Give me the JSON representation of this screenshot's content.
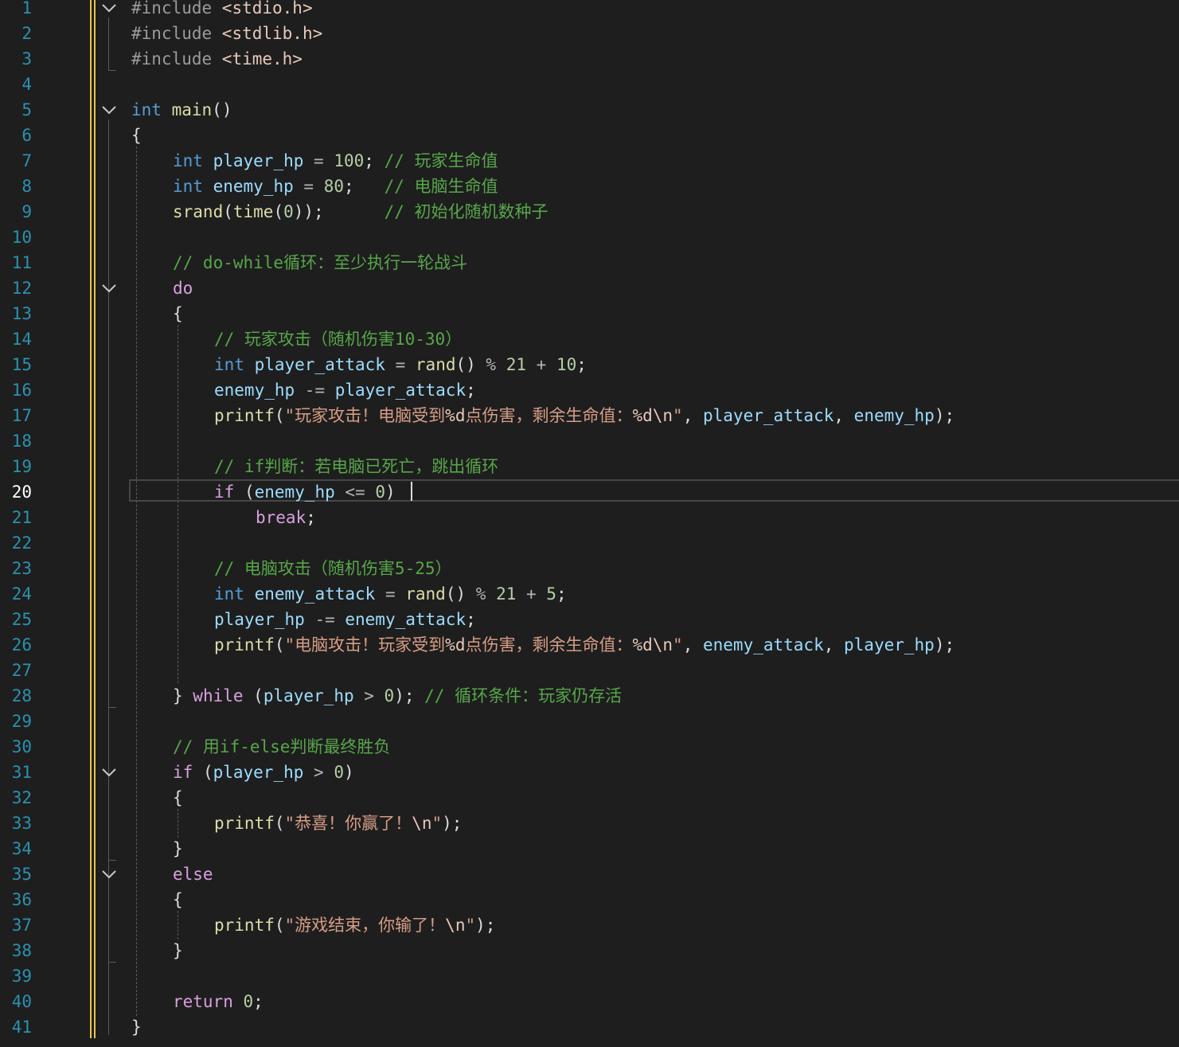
{
  "editor": {
    "active_line": 20,
    "line_numbers": [
      "1",
      "2",
      "3",
      "4",
      "5",
      "6",
      "7",
      "8",
      "9",
      "10",
      "11",
      "12",
      "13",
      "14",
      "15",
      "16",
      "17",
      "18",
      "19",
      "20",
      "21",
      "22",
      "23",
      "24",
      "25",
      "26",
      "27",
      "28",
      "29",
      "30",
      "31",
      "32",
      "33",
      "34",
      "35",
      "36",
      "37",
      "38",
      "39",
      "40",
      "41"
    ],
    "lines": [
      {
        "indent": 0,
        "tokens": [
          {
            "t": "pp",
            "v": "#include "
          },
          {
            "t": "hdr",
            "v": "<stdio.h>"
          }
        ]
      },
      {
        "indent": 0,
        "tokens": [
          {
            "t": "pp",
            "v": "#include "
          },
          {
            "t": "hdr",
            "v": "<stdlib.h>"
          }
        ]
      },
      {
        "indent": 0,
        "tokens": [
          {
            "t": "pp",
            "v": "#include "
          },
          {
            "t": "hdr",
            "v": "<time.h>"
          }
        ]
      },
      {
        "indent": 0,
        "tokens": []
      },
      {
        "indent": 0,
        "tokens": [
          {
            "t": "kw",
            "v": "int"
          },
          {
            "t": "pl",
            "v": " "
          },
          {
            "t": "fn",
            "v": "main"
          },
          {
            "t": "pl",
            "v": "()"
          }
        ]
      },
      {
        "indent": 0,
        "tokens": [
          {
            "t": "pl",
            "v": "{"
          }
        ]
      },
      {
        "indent": 1,
        "tokens": [
          {
            "t": "kw",
            "v": "int"
          },
          {
            "t": "pl",
            "v": " "
          },
          {
            "t": "var",
            "v": "player_hp"
          },
          {
            "t": "op",
            "v": " = "
          },
          {
            "t": "num",
            "v": "100"
          },
          {
            "t": "pl",
            "v": "; "
          },
          {
            "t": "cm",
            "v": "// 玩家生命值"
          }
        ]
      },
      {
        "indent": 1,
        "tokens": [
          {
            "t": "kw",
            "v": "int"
          },
          {
            "t": "pl",
            "v": " "
          },
          {
            "t": "var",
            "v": "enemy_hp"
          },
          {
            "t": "op",
            "v": " = "
          },
          {
            "t": "num",
            "v": "80"
          },
          {
            "t": "pl",
            "v": ";   "
          },
          {
            "t": "cm",
            "v": "// 电脑生命值"
          }
        ]
      },
      {
        "indent": 1,
        "tokens": [
          {
            "t": "fn",
            "v": "srand"
          },
          {
            "t": "pl",
            "v": "("
          },
          {
            "t": "fn",
            "v": "time"
          },
          {
            "t": "pl",
            "v": "("
          },
          {
            "t": "num",
            "v": "0"
          },
          {
            "t": "pl",
            "v": "));      "
          },
          {
            "t": "cm",
            "v": "// 初始化随机数种子"
          }
        ]
      },
      {
        "indent": 1,
        "tokens": []
      },
      {
        "indent": 1,
        "tokens": [
          {
            "t": "cm",
            "v": "// do-while循环：至少执行一轮战斗"
          }
        ]
      },
      {
        "indent": 1,
        "tokens": [
          {
            "t": "ctl",
            "v": "do"
          }
        ]
      },
      {
        "indent": 1,
        "tokens": [
          {
            "t": "pl",
            "v": "{"
          }
        ]
      },
      {
        "indent": 2,
        "tokens": [
          {
            "t": "cm",
            "v": "// 玩家攻击（随机伤害10-30）"
          }
        ]
      },
      {
        "indent": 2,
        "tokens": [
          {
            "t": "kw",
            "v": "int"
          },
          {
            "t": "pl",
            "v": " "
          },
          {
            "t": "var",
            "v": "player_attack"
          },
          {
            "t": "op",
            "v": " = "
          },
          {
            "t": "fn",
            "v": "rand"
          },
          {
            "t": "pl",
            "v": "()"
          },
          {
            "t": "op",
            "v": " % "
          },
          {
            "t": "num",
            "v": "21"
          },
          {
            "t": "op",
            "v": " + "
          },
          {
            "t": "num",
            "v": "10"
          },
          {
            "t": "pl",
            "v": ";"
          }
        ]
      },
      {
        "indent": 2,
        "tokens": [
          {
            "t": "var",
            "v": "enemy_hp"
          },
          {
            "t": "op",
            "v": " -= "
          },
          {
            "t": "var",
            "v": "player_attack"
          },
          {
            "t": "pl",
            "v": ";"
          }
        ]
      },
      {
        "indent": 2,
        "tokens": [
          {
            "t": "fn",
            "v": "printf"
          },
          {
            "t": "pl",
            "v": "("
          },
          {
            "t": "str",
            "v": "\"玩家攻击！电脑受到"
          },
          {
            "t": "esc",
            "v": "%d"
          },
          {
            "t": "str",
            "v": "点伤害，剩余生命值："
          },
          {
            "t": "esc",
            "v": "%d\\n"
          },
          {
            "t": "str",
            "v": "\""
          },
          {
            "t": "pl",
            "v": ", "
          },
          {
            "t": "var",
            "v": "player_attack"
          },
          {
            "t": "pl",
            "v": ", "
          },
          {
            "t": "var",
            "v": "enemy_hp"
          },
          {
            "t": "pl",
            "v": ");"
          }
        ]
      },
      {
        "indent": 2,
        "tokens": []
      },
      {
        "indent": 2,
        "tokens": [
          {
            "t": "cm",
            "v": "// if判断：若电脑已死亡，跳出循环"
          }
        ]
      },
      {
        "indent": 2,
        "tokens": [
          {
            "t": "ctl",
            "v": "if"
          },
          {
            "t": "pl",
            "v": " ("
          },
          {
            "t": "var",
            "v": "enemy_hp"
          },
          {
            "t": "op",
            "v": " <= "
          },
          {
            "t": "num",
            "v": "0"
          },
          {
            "t": "pl",
            "v": ")"
          }
        ]
      },
      {
        "indent": 3,
        "tokens": [
          {
            "t": "ctl",
            "v": "break"
          },
          {
            "t": "pl",
            "v": ";"
          }
        ]
      },
      {
        "indent": 2,
        "tokens": []
      },
      {
        "indent": 2,
        "tokens": [
          {
            "t": "cm",
            "v": "// 电脑攻击（随机伤害5-25）"
          }
        ]
      },
      {
        "indent": 2,
        "tokens": [
          {
            "t": "kw",
            "v": "int"
          },
          {
            "t": "pl",
            "v": " "
          },
          {
            "t": "var",
            "v": "enemy_attack"
          },
          {
            "t": "op",
            "v": " = "
          },
          {
            "t": "fn",
            "v": "rand"
          },
          {
            "t": "pl",
            "v": "()"
          },
          {
            "t": "op",
            "v": " % "
          },
          {
            "t": "num",
            "v": "21"
          },
          {
            "t": "op",
            "v": " + "
          },
          {
            "t": "num",
            "v": "5"
          },
          {
            "t": "pl",
            "v": ";"
          }
        ]
      },
      {
        "indent": 2,
        "tokens": [
          {
            "t": "var",
            "v": "player_hp"
          },
          {
            "t": "op",
            "v": " -= "
          },
          {
            "t": "var",
            "v": "enemy_attack"
          },
          {
            "t": "pl",
            "v": ";"
          }
        ]
      },
      {
        "indent": 2,
        "tokens": [
          {
            "t": "fn",
            "v": "printf"
          },
          {
            "t": "pl",
            "v": "("
          },
          {
            "t": "str",
            "v": "\"电脑攻击！玩家受到"
          },
          {
            "t": "esc",
            "v": "%d"
          },
          {
            "t": "str",
            "v": "点伤害，剩余生命值："
          },
          {
            "t": "esc",
            "v": "%d\\n"
          },
          {
            "t": "str",
            "v": "\""
          },
          {
            "t": "pl",
            "v": ", "
          },
          {
            "t": "var",
            "v": "enemy_attack"
          },
          {
            "t": "pl",
            "v": ", "
          },
          {
            "t": "var",
            "v": "player_hp"
          },
          {
            "t": "pl",
            "v": ");"
          }
        ]
      },
      {
        "indent": 2,
        "tokens": []
      },
      {
        "indent": 1,
        "tokens": [
          {
            "t": "pl",
            "v": "} "
          },
          {
            "t": "ctl",
            "v": "while"
          },
          {
            "t": "pl",
            "v": " ("
          },
          {
            "t": "var",
            "v": "player_hp"
          },
          {
            "t": "op",
            "v": " > "
          },
          {
            "t": "num",
            "v": "0"
          },
          {
            "t": "pl",
            "v": "); "
          },
          {
            "t": "cm",
            "v": "// 循环条件：玩家仍存活"
          }
        ]
      },
      {
        "indent": 1,
        "tokens": []
      },
      {
        "indent": 1,
        "tokens": [
          {
            "t": "cm",
            "v": "// 用if-else判断最终胜负"
          }
        ]
      },
      {
        "indent": 1,
        "tokens": [
          {
            "t": "ctl",
            "v": "if"
          },
          {
            "t": "pl",
            "v": " ("
          },
          {
            "t": "var",
            "v": "player_hp"
          },
          {
            "t": "op",
            "v": " > "
          },
          {
            "t": "num",
            "v": "0"
          },
          {
            "t": "pl",
            "v": ")"
          }
        ]
      },
      {
        "indent": 1,
        "tokens": [
          {
            "t": "pl",
            "v": "{"
          }
        ]
      },
      {
        "indent": 2,
        "tokens": [
          {
            "t": "fn",
            "v": "printf"
          },
          {
            "t": "pl",
            "v": "("
          },
          {
            "t": "str",
            "v": "\"恭喜！你赢了！"
          },
          {
            "t": "esc",
            "v": "\\n"
          },
          {
            "t": "str",
            "v": "\""
          },
          {
            "t": "pl",
            "v": ");"
          }
        ]
      },
      {
        "indent": 1,
        "tokens": [
          {
            "t": "pl",
            "v": "}"
          }
        ]
      },
      {
        "indent": 1,
        "tokens": [
          {
            "t": "ctl",
            "v": "else"
          }
        ]
      },
      {
        "indent": 1,
        "tokens": [
          {
            "t": "pl",
            "v": "{"
          }
        ]
      },
      {
        "indent": 2,
        "tokens": [
          {
            "t": "fn",
            "v": "printf"
          },
          {
            "t": "pl",
            "v": "("
          },
          {
            "t": "str",
            "v": "\"游戏结束，你输了！"
          },
          {
            "t": "esc",
            "v": "\\n"
          },
          {
            "t": "str",
            "v": "\""
          },
          {
            "t": "pl",
            "v": ");"
          }
        ]
      },
      {
        "indent": 1,
        "tokens": [
          {
            "t": "pl",
            "v": "}"
          }
        ]
      },
      {
        "indent": 1,
        "tokens": []
      },
      {
        "indent": 1,
        "tokens": [
          {
            "t": "ctl",
            "v": "return"
          },
          {
            "t": "pl",
            "v": " "
          },
          {
            "t": "num",
            "v": "0"
          },
          {
            "t": "pl",
            "v": ";"
          }
        ]
      },
      {
        "indent": 0,
        "tokens": [
          {
            "t": "pl",
            "v": "}"
          }
        ]
      }
    ],
    "fold_markers": [
      1,
      5,
      12,
      31,
      35
    ],
    "fold_icon": "chevron-down-icon",
    "colors": {
      "background": "#1e1e1e",
      "line_number": "#2b91af",
      "change_bar": "#e6c54c",
      "keyword": "#569cd6",
      "control": "#d8a0df",
      "function": "#dcdcaa",
      "variable": "#9cdcfe",
      "number": "#b5cea8",
      "string": "#d69d85",
      "comment": "#57a64a"
    }
  }
}
